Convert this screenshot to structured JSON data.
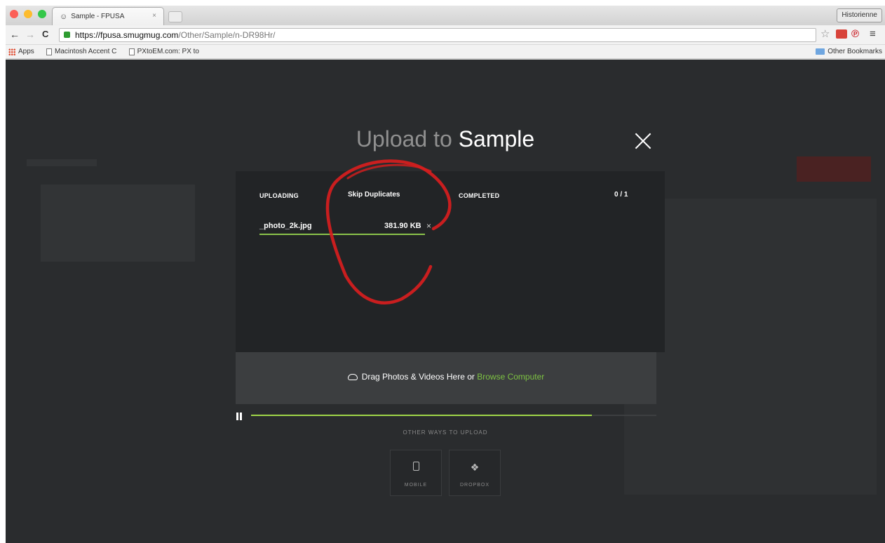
{
  "browser": {
    "tab_title": "Sample - FPUSA",
    "tab_close": "×",
    "profile_name": "Historienne",
    "url_host": "https://fpusa.smugmug.com",
    "url_path": "/Other/Sample/n-DR98Hr/",
    "back_glyph": "←",
    "forward_glyph": "→",
    "reload_glyph": "C",
    "menu_glyph": "≡",
    "star_glyph": "☆",
    "pinterest_glyph": "℗",
    "bookmarks": [
      {
        "label": "Apps",
        "icon": "apps-grid-icon"
      },
      {
        "label": "Macintosh Accent C",
        "icon": "page-icon"
      },
      {
        "label": "PXtoEM.com: PX to",
        "icon": "page-icon"
      }
    ],
    "other_bookmarks": "Other Bookmarks",
    "traffic_light_colors": [
      "#fc5f57",
      "#fdbc2e",
      "#34c749"
    ]
  },
  "modal": {
    "title_prefix": "Upload to ",
    "title_gallery": "Sample",
    "uploading_label": "UPLOADING",
    "skip_duplicates_label": "Skip Duplicates",
    "completed_label": "COMPLETED",
    "completed_count": "0 / 1",
    "file": {
      "name": "_photo_2k.jpg",
      "size": "381.90 KB",
      "remove_glyph": "×",
      "progress": 1.0
    },
    "drop_text": "Drag Photos & Videos Here or ",
    "browse_link": "Browse Computer",
    "overall_progress": 0.84,
    "other_ways_label": "OTHER WAYS TO UPLOAD",
    "ways": [
      {
        "label": "MOBILE",
        "icon": "mobile-icon"
      },
      {
        "label": "DROPBOX",
        "icon": "dropbox-icon"
      }
    ]
  },
  "colors": {
    "accent_green": "#7dc242",
    "annotation_red": "#d81e1e"
  }
}
